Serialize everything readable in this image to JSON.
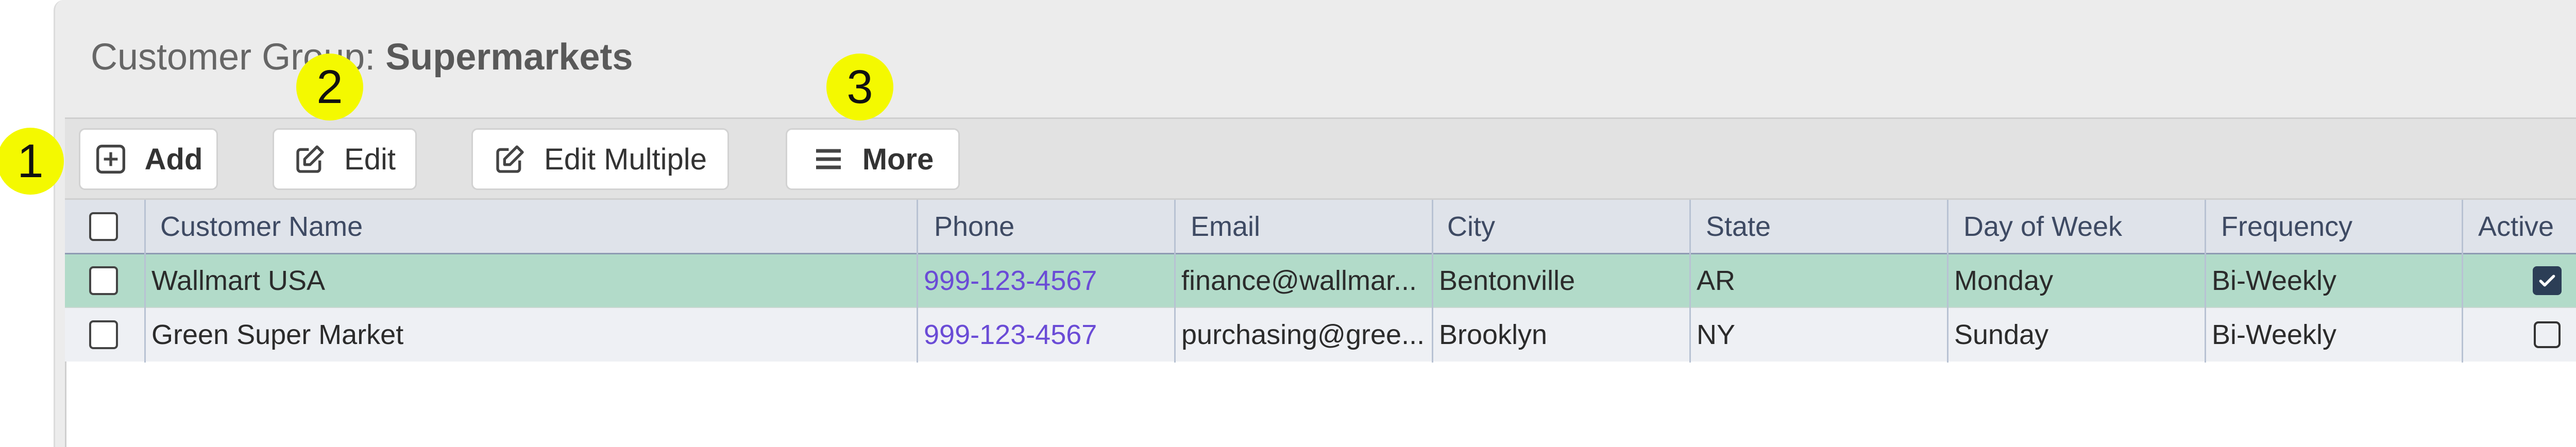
{
  "page": {
    "title_prefix": "Customer Group: ",
    "title_name": "Supermarkets"
  },
  "toolbar": {
    "add_label": "Add",
    "edit_label": "Edit",
    "edit_multiple_label": "Edit Multiple",
    "more_label": "More"
  },
  "markers": [
    "1",
    "2",
    "3"
  ],
  "table": {
    "columns": [
      "Customer Name",
      "Phone",
      "Email",
      "City",
      "State",
      "Day of Week",
      "Frequency",
      "Active"
    ],
    "rows": [
      {
        "selected": false,
        "customer_name": "Wallmart USA",
        "phone": "999-123-4567",
        "email": "finance@wallmar...",
        "city": "Bentonville",
        "state": "AR",
        "day_of_week": "Monday",
        "frequency": "Bi-Weekly",
        "active": true
      },
      {
        "selected": false,
        "customer_name": "Green Super Market",
        "phone": "999-123-4567",
        "email": "purchasing@gree...",
        "city": "Brooklyn",
        "state": "NY",
        "day_of_week": "Sunday",
        "frequency": "Bi-Weekly",
        "active": false
      }
    ]
  },
  "colors": {
    "selected_row": "#b2dbc9",
    "phone_link": "#6a4bd6",
    "marker": "#f4f900",
    "header_bg": "#dfe3ea"
  }
}
